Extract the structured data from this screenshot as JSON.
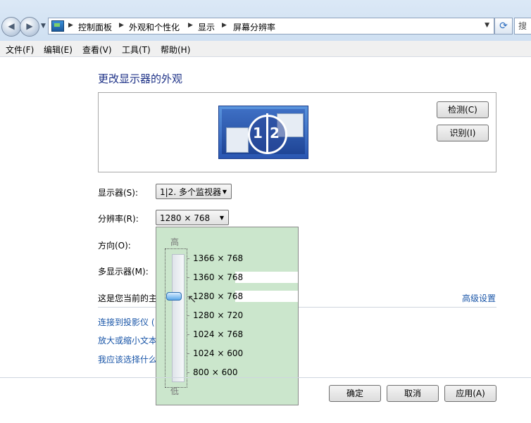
{
  "address": {
    "breadcrumbs": [
      "控制面板",
      "外观和个性化",
      "显示",
      "屏幕分辨率"
    ],
    "search_placeholder": "搜"
  },
  "menu": [
    "文件(F)",
    "编辑(E)",
    "查看(V)",
    "工具(T)",
    "帮助(H)"
  ],
  "page_title": "更改显示器的外观",
  "preview": {
    "monitor_numbers": [
      "1",
      "2"
    ],
    "detect_button": "检测(C)",
    "identify_button": "识别(I)"
  },
  "fields": {
    "display_label": "显示器(S):",
    "display_value": "1|2. 多个监视器",
    "resolution_label": "分辨率(R):",
    "resolution_value": "1280 × 768",
    "orientation_label": "方向(O):",
    "multi_display_label": "多显示器(M):"
  },
  "current_display_text": "这是您当前的主",
  "advanced_settings_link": "高级设置",
  "links": [
    "连接到投影仪 (",
    "放大或缩小文本",
    "我应该选择什么"
  ],
  "resolution_dropdown": {
    "high_label": "高",
    "low_label": "低",
    "options": [
      "1366 × 768",
      "1360 × 768",
      "1280 × 768",
      "1280 × 720",
      "1024 × 768",
      "1024 × 600",
      "800 × 600"
    ],
    "selected": "1280 × 768",
    "slider_position_index": 2
  },
  "footer": {
    "ok_button": "确定",
    "cancel_button": "取消",
    "apply_button": "应用(A)"
  }
}
